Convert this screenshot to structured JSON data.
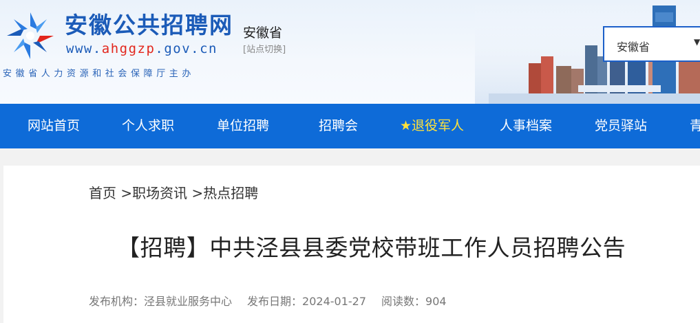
{
  "header": {
    "site_title": "安徽公共招聘网",
    "site_url_prefix": "www.",
    "site_url_domain": "ahggzp",
    "site_url_suffix": ".gov.cn",
    "sponsor": "安徽省人力资源和社会保障厅主办",
    "province": "安徽省",
    "switch_label": "[站点切换]",
    "region_select": {
      "selected": "安徽省"
    },
    "colors": {
      "brand_blue": "#1b5bb8",
      "url_domain_red": "#e2261c"
    },
    "icons": {
      "logo": "logo-mark-icon",
      "dropdown": "chevron-down-icon"
    }
  },
  "nav": {
    "background_color": "#0e6bd8",
    "highlight_color": "#ffe23b",
    "items": [
      {
        "label": "网站首页"
      },
      {
        "label": "个人求职"
      },
      {
        "label": "单位招聘"
      },
      {
        "label": "招聘会"
      },
      {
        "label": "★退役军人"
      },
      {
        "label": "人事档案"
      },
      {
        "label": "党员驿站"
      },
      {
        "label": "青"
      }
    ]
  },
  "breadcrumb": {
    "items": [
      {
        "label": "首页"
      },
      {
        "label": ">职场资讯"
      },
      {
        "label": ">热点招聘"
      }
    ]
  },
  "article": {
    "title": "【招聘】中共泾县县委党校带班工作人员招聘公告",
    "publisher_label": "发布机构：",
    "publisher": "泾县就业服务中心",
    "date_label": "发布日期：",
    "date": "2024-01-27",
    "views_label": "阅读数：",
    "views": "904"
  }
}
